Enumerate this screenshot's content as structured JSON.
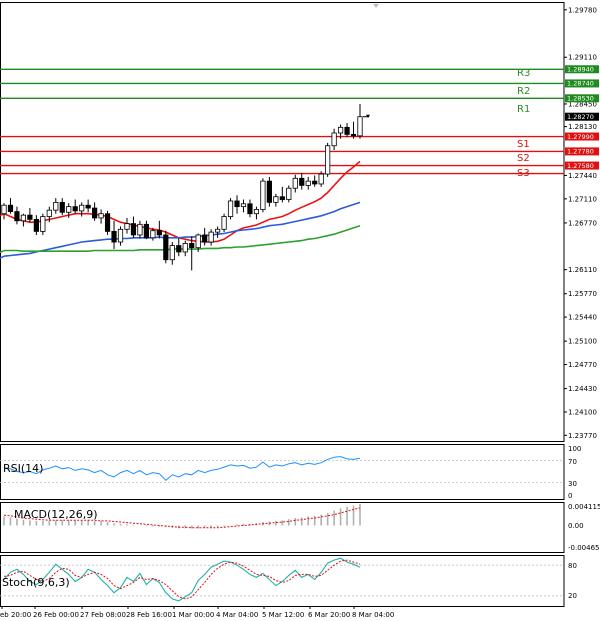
{
  "chart_data": {
    "type": "candlestick",
    "price_ticks": [
      "1.29780",
      "1.29110",
      "1.28450",
      "1.28130",
      "1.27440",
      "1.27110",
      "1.26770",
      "1.26110",
      "1.25770",
      "1.25440",
      "1.25100",
      "1.24770",
      "1.24430",
      "1.24100",
      "1.23770"
    ],
    "price_range": [
      1.2369,
      1.2989
    ],
    "levels": [
      {
        "name": "R3",
        "price": 1.2894,
        "label": "1.28940",
        "color": "#1f8a1f"
      },
      {
        "name": "R2",
        "price": 1.2874,
        "label": "1.28740",
        "color": "#1f8a1f"
      },
      {
        "name": "R1",
        "price": 1.2853,
        "label": "1.28530",
        "color": "#1f8a1f"
      },
      {
        "name": "",
        "price": 1.2799,
        "label": "1.27990",
        "color": "#e01010"
      },
      {
        "name": "S1",
        "price": 1.2778,
        "label": "1.27780",
        "color": "#e01010"
      },
      {
        "name": "S2",
        "price": 1.2758,
        "label": "1.27580",
        "color": "#e01010"
      },
      {
        "name": "S3",
        "price": 1.2758,
        "label": "",
        "color": "#e01010"
      }
    ],
    "current_price": {
      "value": 1.2827,
      "label": "1.28270"
    },
    "x_labels": [
      "eb 20:00",
      "26 Feb 00:00",
      "27 Feb 08:00",
      "28 Feb 16:00",
      "1 Mar 00:00",
      "4 Mar 04:00",
      "5 Mar 12:00",
      "6 Mar 20:00",
      "8 Mar 04:00"
    ],
    "candles": [
      [
        1.269,
        1.2705,
        1.2682,
        1.2702
      ],
      [
        1.2702,
        1.2712,
        1.269,
        1.2693
      ],
      [
        1.2693,
        1.27,
        1.2675,
        1.268
      ],
      [
        1.268,
        1.269,
        1.2672,
        1.2688
      ],
      [
        1.2688,
        1.2698,
        1.2678,
        1.2682
      ],
      [
        1.2682,
        1.2688,
        1.266,
        1.2665
      ],
      [
        1.2665,
        1.269,
        1.266,
        1.2686
      ],
      [
        1.2686,
        1.27,
        1.2678,
        1.2695
      ],
      [
        1.2695,
        1.2712,
        1.269,
        1.2706
      ],
      [
        1.2706,
        1.2712,
        1.2688,
        1.2692
      ],
      [
        1.2692,
        1.2705,
        1.2684,
        1.27
      ],
      [
        1.27,
        1.271,
        1.269,
        1.2694
      ],
      [
        1.2694,
        1.2706,
        1.2686,
        1.2702
      ],
      [
        1.2702,
        1.271,
        1.2692,
        1.2698
      ],
      [
        1.2698,
        1.2706,
        1.268,
        1.2684
      ],
      [
        1.2684,
        1.2696,
        1.2676,
        1.269
      ],
      [
        1.269,
        1.2694,
        1.266,
        1.2665
      ],
      [
        1.2665,
        1.268,
        1.264,
        1.265
      ],
      [
        1.265,
        1.2672,
        1.2645,
        1.2668
      ],
      [
        1.2668,
        1.2684,
        1.2662,
        1.2676
      ],
      [
        1.2676,
        1.2686,
        1.2656,
        1.266
      ],
      [
        1.266,
        1.268,
        1.2655,
        1.2675
      ],
      [
        1.2675,
        1.268,
        1.2654,
        1.2656
      ],
      [
        1.2656,
        1.267,
        1.2652,
        1.2666
      ],
      [
        1.2666,
        1.268,
        1.2655,
        1.266
      ],
      [
        1.266,
        1.2666,
        1.262,
        1.2625
      ],
      [
        1.2625,
        1.265,
        1.2618,
        1.2645
      ],
      [
        1.2645,
        1.2655,
        1.263,
        1.2636
      ],
      [
        1.2636,
        1.2652,
        1.263,
        1.2648
      ],
      [
        1.2648,
        1.2658,
        1.261,
        1.2642
      ],
      [
        1.2642,
        1.2662,
        1.2636,
        1.266
      ],
      [
        1.266,
        1.267,
        1.2645,
        1.265
      ],
      [
        1.265,
        1.2668,
        1.2645,
        1.2664
      ],
      [
        1.2664,
        1.2672,
        1.2656,
        1.2668
      ],
      [
        1.2668,
        1.269,
        1.2664,
        1.2686
      ],
      [
        1.2686,
        1.2712,
        1.2682,
        1.2708
      ],
      [
        1.2708,
        1.2716,
        1.269,
        1.27
      ],
      [
        1.27,
        1.271,
        1.2692,
        1.2704
      ],
      [
        1.2704,
        1.271,
        1.2685,
        1.269
      ],
      [
        1.269,
        1.27,
        1.2682,
        1.2696
      ],
      [
        1.2696,
        1.274,
        1.2692,
        1.2736
      ],
      [
        1.2736,
        1.2742,
        1.27,
        1.2706
      ],
      [
        1.2706,
        1.2718,
        1.27,
        1.2714
      ],
      [
        1.2714,
        1.2728,
        1.2706,
        1.271
      ],
      [
        1.271,
        1.273,
        1.2706,
        1.2726
      ],
      [
        1.2726,
        1.2745,
        1.272,
        1.274
      ],
      [
        1.274,
        1.2748,
        1.2724,
        1.273
      ],
      [
        1.273,
        1.2742,
        1.2724,
        1.2736
      ],
      [
        1.2736,
        1.2744,
        1.2728,
        1.2732
      ],
      [
        1.2732,
        1.275,
        1.2728,
        1.2746
      ],
      [
        1.2746,
        1.279,
        1.2742,
        1.2786
      ],
      [
        1.2786,
        1.281,
        1.278,
        1.2804
      ],
      [
        1.2804,
        1.2816,
        1.2796,
        1.2812
      ],
      [
        1.2812,
        1.2818,
        1.2798,
        1.2802
      ],
      [
        1.2802,
        1.282,
        1.2796,
        1.28
      ],
      [
        1.28,
        1.2845,
        1.2796,
        1.2827
      ]
    ],
    "ma": [
      {
        "name": "",
        "color": "#ee1111",
        "values": [
          1.269,
          1.2686,
          1.2682,
          1.268,
          1.2678,
          1.2678,
          1.268,
          1.2682,
          1.2684,
          1.2686,
          1.2688,
          1.269,
          1.269,
          1.269,
          1.2689,
          1.2688,
          1.2686,
          1.2682,
          1.2678,
          1.2676,
          1.2674,
          1.2672,
          1.267,
          1.2668,
          1.2667,
          1.2664,
          1.266,
          1.2656,
          1.2654,
          1.2652,
          1.2651,
          1.265,
          1.265,
          1.2651,
          1.2654,
          1.266,
          1.2666,
          1.267,
          1.2672,
          1.2674,
          1.2678,
          1.2682,
          1.2684,
          1.2686,
          1.269,
          1.2695,
          1.2699,
          1.2703,
          1.2707,
          1.2712,
          1.272,
          1.273,
          1.274,
          1.2749,
          1.2756,
          1.2764
        ]
      },
      {
        "name": "",
        "color": "#2a5bdc",
        "values": [
          1.263,
          1.2631,
          1.2632,
          1.2633,
          1.2634,
          1.2636,
          1.2638,
          1.264,
          1.2642,
          1.2644,
          1.2646,
          1.2648,
          1.265,
          1.2651,
          1.2652,
          1.2653,
          1.2654,
          1.2654,
          1.2655,
          1.2655,
          1.2656,
          1.2656,
          1.2656,
          1.2656,
          1.2657,
          1.2656,
          1.2656,
          1.2656,
          1.2657,
          1.2657,
          1.2658,
          1.2659,
          1.266,
          1.2661,
          1.2662,
          1.2664,
          1.2666,
          1.2667,
          1.2668,
          1.2669,
          1.2671,
          1.2673,
          1.2674,
          1.2675,
          1.2677,
          1.2679,
          1.2681,
          1.2683,
          1.2685,
          1.2687,
          1.269,
          1.2693,
          1.2697,
          1.27,
          1.2703,
          1.2706
        ]
      },
      {
        "name": "",
        "color": "#2ea02e",
        "values": [
          1.2638,
          1.2638,
          1.2638,
          1.2637,
          1.2637,
          1.2637,
          1.2637,
          1.2637,
          1.2637,
          1.2637,
          1.2637,
          1.2637,
          1.2637,
          1.2637,
          1.2638,
          1.2638,
          1.2638,
          1.2638,
          1.2638,
          1.2638,
          1.2638,
          1.2639,
          1.2639,
          1.2639,
          1.2639,
          1.2639,
          1.264,
          1.264,
          1.264,
          1.264,
          1.264,
          1.2641,
          1.2641,
          1.2641,
          1.2642,
          1.2642,
          1.2643,
          1.2643,
          1.2644,
          1.2645,
          1.2646,
          1.2647,
          1.2648,
          1.2649,
          1.265,
          1.2651,
          1.2652,
          1.2654,
          1.2655,
          1.2657,
          1.2659,
          1.2661,
          1.2664,
          1.2667,
          1.267,
          1.2673
        ]
      }
    ],
    "indicators": {
      "rsi": {
        "label": "RSI(14)",
        "ticks": [
          "100",
          "70",
          "30",
          "0"
        ],
        "values": [
          57,
          55,
          50,
          48,
          50,
          46,
          53,
          56,
          60,
          55,
          57,
          52,
          55,
          53,
          48,
          52,
          44,
          40,
          48,
          52,
          46,
          52,
          44,
          48,
          46,
          34,
          44,
          40,
          46,
          44,
          52,
          48,
          52,
          54,
          58,
          62,
          60,
          61,
          56,
          58,
          67,
          58,
          62,
          60,
          64,
          66,
          62,
          65,
          63,
          66,
          72,
          76,
          77,
          73,
          72,
          74
        ],
        "levels": [
          70,
          30
        ]
      },
      "macd": {
        "label": "MACD(12,26,9)",
        "ticks": [
          "0.004115",
          "0.00",
          "-0.004651"
        ],
        "range": [
          -0.004651,
          0.004115
        ],
        "hist": [
          0.0016,
          0.0014,
          0.0012,
          0.001,
          0.0009,
          0.0008,
          0.0008,
          0.0008,
          0.0009,
          0.0009,
          0.0009,
          0.0009,
          0.0009,
          0.0009,
          0.0008,
          0.0008,
          0.0006,
          0.0004,
          0.0003,
          0.0002,
          0.0001,
          0.0,
          -0.0001,
          -0.0002,
          -0.0002,
          -0.0003,
          -0.0004,
          -0.0005,
          -0.0005,
          -0.0005,
          -0.0005,
          -0.0004,
          -0.0004,
          -0.0003,
          -0.0002,
          0.0,
          0.0002,
          0.0003,
          0.0003,
          0.0004,
          0.0006,
          0.0007,
          0.0008,
          0.0009,
          0.0011,
          0.0013,
          0.0014,
          0.0016,
          0.0017,
          0.0019,
          0.0022,
          0.0026,
          0.003,
          0.0033,
          0.0035,
          0.0038
        ],
        "signal": [
          0.0018,
          0.0017,
          0.0015,
          0.0013,
          0.0012,
          0.0011,
          0.001,
          0.0009,
          0.0009,
          0.0009,
          0.0009,
          0.0009,
          0.0009,
          0.0009,
          0.0009,
          0.0008,
          0.0008,
          0.0007,
          0.0006,
          0.0005,
          0.0004,
          0.0003,
          0.0002,
          0.0001,
          0.0,
          -0.0001,
          -0.0002,
          -0.0003,
          -0.0003,
          -0.0004,
          -0.0004,
          -0.0004,
          -0.0004,
          -0.0004,
          -0.0003,
          -0.0002,
          -0.0001,
          0.0,
          0.0001,
          0.0002,
          0.0003,
          0.0004,
          0.0005,
          0.0006,
          0.0007,
          0.0009,
          0.001,
          0.0012,
          0.0013,
          0.0015,
          0.0017,
          0.0019,
          0.0022,
          0.0025,
          0.0028,
          0.0031
        ]
      },
      "stoch": {
        "label": "Stoch(9,6,3)",
        "ticks": [
          "80",
          "20"
        ],
        "k": [
          52,
          66,
          72,
          62,
          48,
          42,
          52,
          66,
          82,
          72,
          62,
          48,
          56,
          72,
          66,
          52,
          40,
          26,
          36,
          56,
          48,
          64,
          42,
          54,
          46,
          26,
          14,
          10,
          18,
          26,
          50,
          62,
          76,
          82,
          88,
          86,
          80,
          72,
          62,
          56,
          64,
          52,
          40,
          48,
          60,
          70,
          56,
          62,
          52,
          66,
          84,
          90,
          94,
          86,
          82,
          76
        ],
        "d": [
          58,
          60,
          66,
          68,
          60,
          52,
          48,
          54,
          66,
          74,
          72,
          60,
          56,
          62,
          66,
          62,
          54,
          40,
          34,
          40,
          46,
          56,
          52,
          54,
          50,
          42,
          30,
          18,
          14,
          18,
          32,
          46,
          62,
          74,
          82,
          86,
          84,
          78,
          70,
          62,
          60,
          58,
          50,
          46,
          50,
          60,
          62,
          62,
          58,
          60,
          70,
          80,
          88,
          90,
          86,
          82
        ],
        "levels": [
          80,
          20
        ]
      }
    }
  }
}
